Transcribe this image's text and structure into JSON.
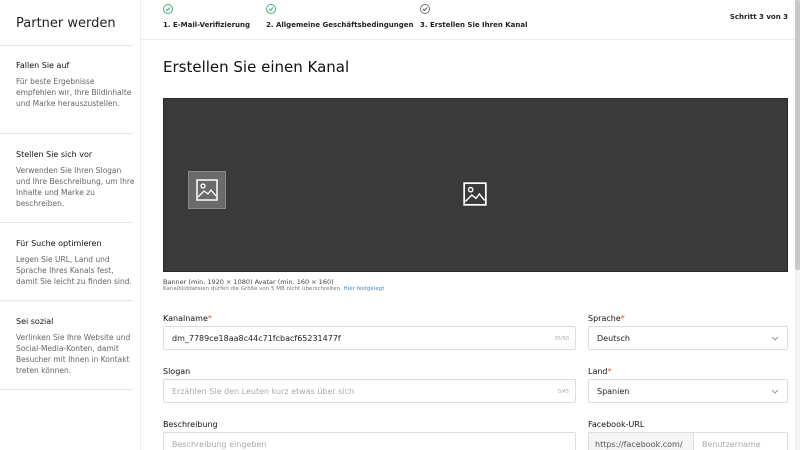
{
  "sidebar": {
    "brand": "Partner werden",
    "sections": [
      {
        "title": "Fallen Sie auf",
        "desc": "Für beste Ergebnisse empfehlen wir, Ihre Bildinhalte und Marke herauszustellen."
      },
      {
        "title": "Stellen Sie sich vor",
        "desc": "Verwenden Sie Ihren Slogan und Ihre Beschreibung, um Ihre Inhalte und Marke zu beschreiben."
      },
      {
        "title": "Für Suche optimieren",
        "desc": "Legen Sie URL, Land und Sprache Ihres Kanals fest, damit Sie leicht zu finden sind."
      },
      {
        "title": "Sei sozial",
        "desc": "Verlinken Sie Ihre Website und Social-Media-Konten, damit Besucher mit Ihnen in Kontakt treten können."
      }
    ]
  },
  "steps": {
    "items": [
      {
        "label": "1. E-Mail-Verifizierung"
      },
      {
        "label": "2. Allgemeine Geschäftsbedingungen"
      },
      {
        "label": "3. Erstellen Sie Ihren Kanal"
      }
    ],
    "count": "Schritt 3 von 3"
  },
  "main": {
    "title": "Erstellen Sie einen Kanal",
    "banner_hint": "Banner (min. 1920 × 1080) Avatar (min. 160 × 160)",
    "size_hint": "Kanalbilddateien dürfen die Größe von 5 MB nicht überschreiten.",
    "size_link": "Hier festgelegt"
  },
  "form": {
    "channel_name": {
      "label": "Kanalname",
      "required_mark": "*",
      "value": "dm_7789ce18aa8c44c71fcbacf65231477f",
      "counter": "35/50"
    },
    "language": {
      "label": "Sprache",
      "required_mark": "*",
      "value": "Deutsch"
    },
    "slogan": {
      "label": "Slogan",
      "placeholder": "Erzählen Sie den Leuten kurz etwas über sich",
      "counter": "0/45"
    },
    "country": {
      "label": "Land",
      "required_mark": "*",
      "value": "Spanien"
    },
    "description": {
      "label": "Beschreibung",
      "placeholder": "Beschreibung eingeben"
    },
    "facebook": {
      "label": "Facebook-URL",
      "prefix": "https://facebook.com/",
      "placeholder": "Benutzername"
    }
  },
  "colors": {
    "accent_green": "#3cb371",
    "link_blue": "#3a8fd6",
    "banner_bg": "#3a3a3a",
    "required_red": "#e74c3c"
  },
  "icons": [
    "check-circle-icon",
    "image-icon",
    "chevron-down-icon"
  ]
}
